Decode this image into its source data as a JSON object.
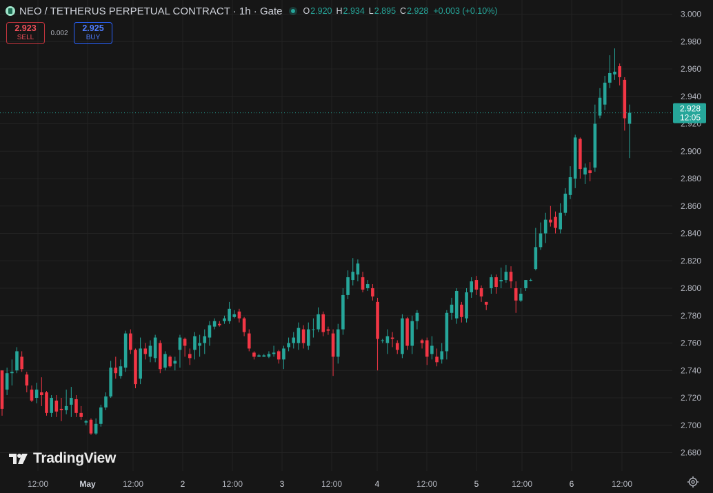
{
  "header": {
    "symbol": "NEO / TETHERUS PERPETUAL CONTRACT · 1h · Gate",
    "ohlc": [
      {
        "k": "O",
        "v": "2.920"
      },
      {
        "k": "H",
        "v": "2.934"
      },
      {
        "k": "L",
        "v": "2.895"
      },
      {
        "k": "C",
        "v": "2.928"
      },
      {
        "k": "",
        "v": "+0.003 (+0.10%)"
      }
    ]
  },
  "trade": {
    "sell_price": "2.923",
    "sell_label": "SELL",
    "spread": "0.002",
    "buy_price": "2.925",
    "buy_label": "BUY"
  },
  "last_price": {
    "value": "2.928",
    "countdown": "12:05"
  },
  "branding": {
    "logo_text": "TradingView"
  },
  "colors": {
    "up": "#26a69a",
    "down": "#f23645",
    "background": "#161616",
    "grid": "#232323"
  },
  "icons": {
    "settings": "gear-icon"
  },
  "chart_data": {
    "type": "candlestick",
    "title": "NEO / TETHERUS PERPETUAL CONTRACT · 1h · Gate",
    "xlabel": "",
    "ylabel": "",
    "ylim": [
      2.67,
      3.005
    ],
    "y_ticks": [
      "3.000",
      "2.980",
      "2.960",
      "2.940",
      "2.920",
      "2.900",
      "2.880",
      "2.860",
      "2.840",
      "2.820",
      "2.800",
      "2.780",
      "2.760",
      "2.740",
      "2.720",
      "2.700",
      "2.680"
    ],
    "x_ticks": [
      "12:00",
      "May",
      "12:00",
      "2",
      "12:00",
      "3",
      "12:00",
      "4",
      "12:00",
      "5",
      "12:00",
      "6",
      "12:00"
    ],
    "grid": true,
    "candles": [
      [
        2.74,
        2.712,
        2.74,
        2.707
      ],
      [
        2.726,
        2.738,
        2.742,
        2.722
      ],
      [
        2.738,
        2.739,
        2.748,
        2.729
      ],
      [
        2.74,
        2.754,
        2.757,
        2.738
      ],
      [
        2.75,
        2.741,
        2.754,
        2.739
      ],
      [
        2.737,
        2.729,
        2.739,
        2.724
      ],
      [
        2.726,
        2.718,
        2.729,
        2.717
      ],
      [
        2.72,
        2.726,
        2.731,
        2.716
      ],
      [
        2.724,
        2.722,
        2.735,
        2.714
      ],
      [
        2.724,
        2.709,
        2.725,
        2.707
      ],
      [
        2.709,
        2.72,
        2.722,
        2.706
      ],
      [
        2.718,
        2.71,
        2.722,
        2.706
      ],
      [
        2.712,
        2.711,
        2.72,
        2.703
      ],
      [
        2.711,
        2.714,
        2.726,
        2.708
      ],
      [
        2.715,
        2.72,
        2.728,
        2.706
      ],
      [
        2.719,
        2.709,
        2.722,
        2.706
      ],
      [
        2.709,
        2.706,
        2.714,
        2.704
      ],
      [
        2.702,
        2.703,
        2.704,
        2.7
      ],
      [
        2.704,
        2.694,
        2.705,
        2.693
      ],
      [
        2.694,
        2.701,
        2.705,
        2.693
      ],
      [
        2.701,
        2.713,
        2.715,
        2.699
      ],
      [
        2.713,
        2.721,
        2.724,
        2.711
      ],
      [
        2.721,
        2.742,
        2.747,
        2.72
      ],
      [
        2.742,
        2.738,
        2.75,
        2.734
      ],
      [
        2.736,
        2.743,
        2.748,
        2.734
      ],
      [
        2.742,
        2.767,
        2.769,
        2.739
      ],
      [
        2.767,
        2.755,
        2.77,
        2.752
      ],
      [
        2.755,
        2.73,
        2.756,
        2.727
      ],
      [
        2.734,
        2.756,
        2.764,
        2.73
      ],
      [
        2.756,
        2.752,
        2.76,
        2.748
      ],
      [
        2.75,
        2.758,
        2.762,
        2.746
      ],
      [
        2.749,
        2.764,
        2.766,
        2.746
      ],
      [
        2.76,
        2.741,
        2.762,
        2.738
      ],
      [
        2.742,
        2.752,
        2.754,
        2.74
      ],
      [
        2.75,
        2.743,
        2.751,
        2.742
      ],
      [
        2.745,
        2.747,
        2.75,
        2.74
      ],
      [
        2.755,
        2.764,
        2.766,
        2.742
      ],
      [
        2.763,
        2.758,
        2.764,
        2.75
      ],
      [
        2.752,
        2.749,
        2.756,
        2.744
      ],
      [
        2.755,
        2.765,
        2.768,
        2.748
      ],
      [
        2.758,
        2.76,
        2.766,
        2.75
      ],
      [
        2.76,
        2.765,
        2.77,
        2.752
      ],
      [
        2.764,
        2.773,
        2.776,
        2.758
      ],
      [
        2.772,
        2.776,
        2.778,
        2.77
      ],
      [
        2.774,
        2.773,
        2.776,
        2.772
      ],
      [
        2.776,
        2.778,
        2.78,
        2.774
      ],
      [
        2.776,
        2.785,
        2.79,
        2.774
      ],
      [
        2.779,
        2.781,
        2.784,
        2.778
      ],
      [
        2.783,
        2.778,
        2.785,
        2.775
      ],
      [
        2.778,
        2.768,
        2.779,
        2.765
      ],
      [
        2.767,
        2.756,
        2.77,
        2.754
      ],
      [
        2.753,
        2.75,
        2.754,
        2.748
      ],
      [
        2.75,
        2.751,
        2.752,
        2.75
      ],
      [
        2.75,
        2.751,
        2.752,
        2.75
      ],
      [
        2.75,
        2.752,
        2.754,
        2.749
      ],
      [
        2.752,
        2.753,
        2.758,
        2.75
      ],
      [
        2.754,
        2.748,
        2.755,
        2.745
      ],
      [
        2.748,
        2.756,
        2.758,
        2.741
      ],
      [
        2.757,
        2.76,
        2.764,
        2.754
      ],
      [
        2.76,
        2.764,
        2.768,
        2.756
      ],
      [
        2.76,
        2.771,
        2.775,
        2.755
      ],
      [
        2.77,
        2.76,
        2.773,
        2.756
      ],
      [
        2.758,
        2.77,
        2.775,
        2.755
      ],
      [
        2.77,
        2.77,
        2.778,
        2.764
      ],
      [
        2.77,
        2.781,
        2.786,
        2.768
      ],
      [
        2.781,
        2.768,
        2.783,
        2.765
      ],
      [
        2.77,
        2.769,
        2.772,
        2.766
      ],
      [
        2.767,
        2.75,
        2.77,
        2.736
      ],
      [
        2.75,
        2.77,
        2.774,
        2.745
      ],
      [
        2.77,
        2.795,
        2.8,
        2.766
      ],
      [
        2.795,
        2.808,
        2.813,
        2.792
      ],
      [
        2.806,
        2.812,
        2.822,
        2.802
      ],
      [
        2.81,
        2.818,
        2.821,
        2.805
      ],
      [
        2.808,
        2.799,
        2.812,
        2.797
      ],
      [
        2.8,
        2.803,
        2.806,
        2.798
      ],
      [
        2.8,
        2.794,
        2.803,
        2.791
      ],
      [
        2.79,
        2.763,
        2.793,
        2.74
      ],
      [
        2.762,
        2.762,
        2.763,
        2.76
      ],
      [
        2.76,
        2.765,
        2.77,
        2.752
      ],
      [
        2.764,
        2.763,
        2.768,
        2.757
      ],
      [
        2.76,
        2.755,
        2.762,
        2.752
      ],
      [
        2.752,
        2.778,
        2.781,
        2.749
      ],
      [
        2.778,
        2.758,
        2.779,
        2.755
      ],
      [
        2.758,
        2.776,
        2.78,
        2.752
      ],
      [
        2.776,
        2.782,
        2.784,
        2.77
      ],
      [
        2.762,
        2.76,
        2.763,
        2.756
      ],
      [
        2.762,
        2.75,
        2.764,
        2.744
      ],
      [
        2.752,
        2.758,
        2.765,
        2.748
      ],
      [
        2.75,
        2.746,
        2.756,
        2.743
      ],
      [
        2.748,
        2.754,
        2.76,
        2.745
      ],
      [
        2.754,
        2.782,
        2.784,
        2.748
      ],
      [
        2.782,
        2.788,
        2.793,
        2.777
      ],
      [
        2.778,
        2.798,
        2.8,
        2.774
      ],
      [
        2.788,
        2.779,
        2.79,
        2.775
      ],
      [
        2.778,
        2.797,
        2.8,
        2.775
      ],
      [
        2.797,
        2.805,
        2.808,
        2.793
      ],
      [
        2.806,
        2.799,
        2.809,
        2.795
      ],
      [
        2.8,
        2.794,
        2.802,
        2.79
      ],
      [
        2.79,
        2.788,
        2.79,
        2.784
      ],
      [
        2.8,
        2.808,
        2.81,
        2.796
      ],
      [
        2.808,
        2.801,
        2.81,
        2.796
      ],
      [
        2.805,
        2.806,
        2.815,
        2.8
      ],
      [
        2.806,
        2.812,
        2.817,
        2.804
      ],
      [
        2.812,
        2.805,
        2.816,
        2.8
      ],
      [
        2.8,
        2.791,
        2.805,
        2.782
      ],
      [
        2.791,
        2.796,
        2.8,
        2.79
      ],
      [
        2.8,
        2.806,
        2.806,
        2.798
      ],
      [
        2.806,
        2.806,
        2.807,
        2.805
      ],
      [
        2.814,
        2.83,
        2.844,
        2.813
      ],
      [
        2.83,
        2.84,
        2.848,
        2.828
      ],
      [
        2.84,
        2.85,
        2.855,
        2.833
      ],
      [
        2.85,
        2.848,
        2.86,
        2.845
      ],
      [
        2.852,
        2.844,
        2.856,
        2.84
      ],
      [
        2.843,
        2.855,
        2.862,
        2.84
      ],
      [
        2.855,
        2.869,
        2.873,
        2.853
      ],
      [
        2.868,
        2.881,
        2.889,
        2.865
      ],
      [
        2.88,
        2.91,
        2.912,
        2.873
      ],
      [
        2.909,
        2.887,
        2.91,
        2.88
      ],
      [
        2.883,
        2.888,
        2.891,
        2.876
      ],
      [
        2.886,
        2.884,
        2.892,
        2.878
      ],
      [
        2.888,
        2.92,
        2.934,
        2.885
      ],
      [
        2.926,
        2.939,
        2.946,
        2.924
      ],
      [
        2.934,
        2.95,
        2.955,
        2.93
      ],
      [
        2.95,
        2.957,
        2.97,
        2.946
      ],
      [
        2.956,
        2.958,
        2.975,
        2.952
      ],
      [
        2.962,
        2.954,
        2.964,
        2.948
      ],
      [
        2.952,
        2.924,
        2.954,
        2.915
      ],
      [
        2.92,
        2.928,
        2.934,
        2.895
      ]
    ]
  }
}
